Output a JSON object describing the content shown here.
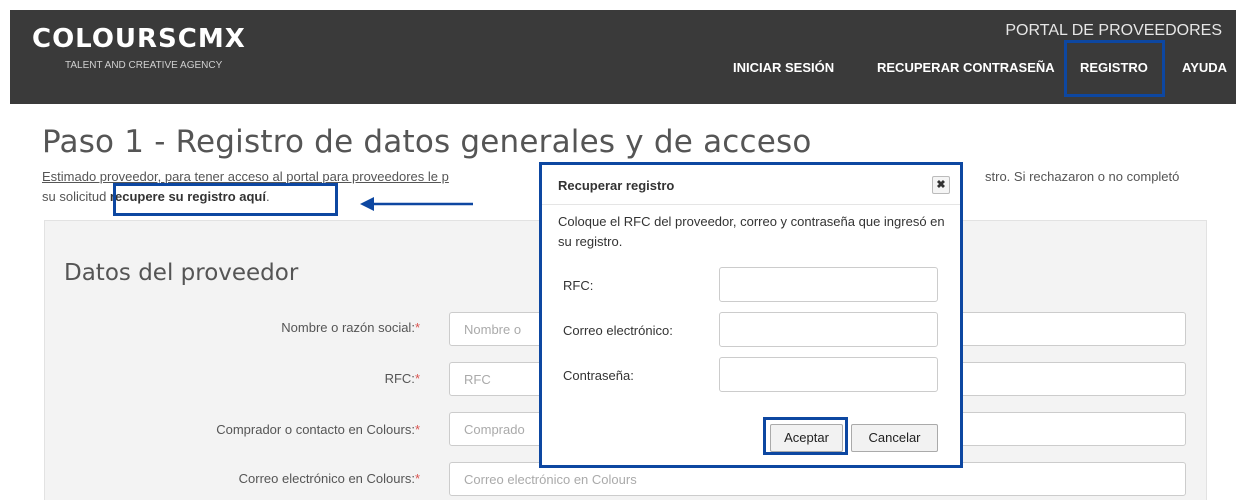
{
  "header": {
    "logo": "COLOURSCMX",
    "tagline": "TALENT AND CREATIVE AGENCY",
    "portal_title": "PORTAL DE PROVEEDORES",
    "nav": [
      "INICIAR SESIÓN",
      "RECUPERAR CONTRASEÑA",
      "REGISTRO",
      "AYUDA"
    ]
  },
  "page": {
    "title": "Paso 1 - Registro de datos generales y de acceso",
    "intro_line1": "Estimado proveedor, para tener acceso al portal para proveedores le p",
    "intro_line1_right": "stro. Si rechazaron o no completó",
    "intro_line2_prefix": "su solicitud ",
    "intro_line2_bold": "recupere su registro aquí",
    "intro_line2_suffix": "."
  },
  "form": {
    "section_title": "Datos del proveedor",
    "fields": [
      {
        "label": "Nombre o razón social:",
        "required": "*",
        "placeholder": "Nombre o"
      },
      {
        "label": "RFC:",
        "required": "*",
        "placeholder": "RFC"
      },
      {
        "label": "Comprador o contacto en Colours:",
        "required": "*",
        "placeholder": "Comprado"
      },
      {
        "label": "Correo electrónico en Colours:",
        "required": "*",
        "placeholder": "Correo electrónico en Colours"
      }
    ]
  },
  "modal": {
    "title": "Recuperar registro",
    "close": "✖",
    "description": "Coloque el RFC del proveedor, correo y contraseña que ingresó en su registro.",
    "fields": [
      {
        "label": "RFC:"
      },
      {
        "label": "Correo electrónico:"
      },
      {
        "label": "Contraseña:"
      }
    ],
    "accept_label": "Aceptar",
    "cancel_label": "Cancelar"
  },
  "colors": {
    "header_bg": "#3a3a3a",
    "highlight": "#0d47a1",
    "required": "#d9534f"
  }
}
